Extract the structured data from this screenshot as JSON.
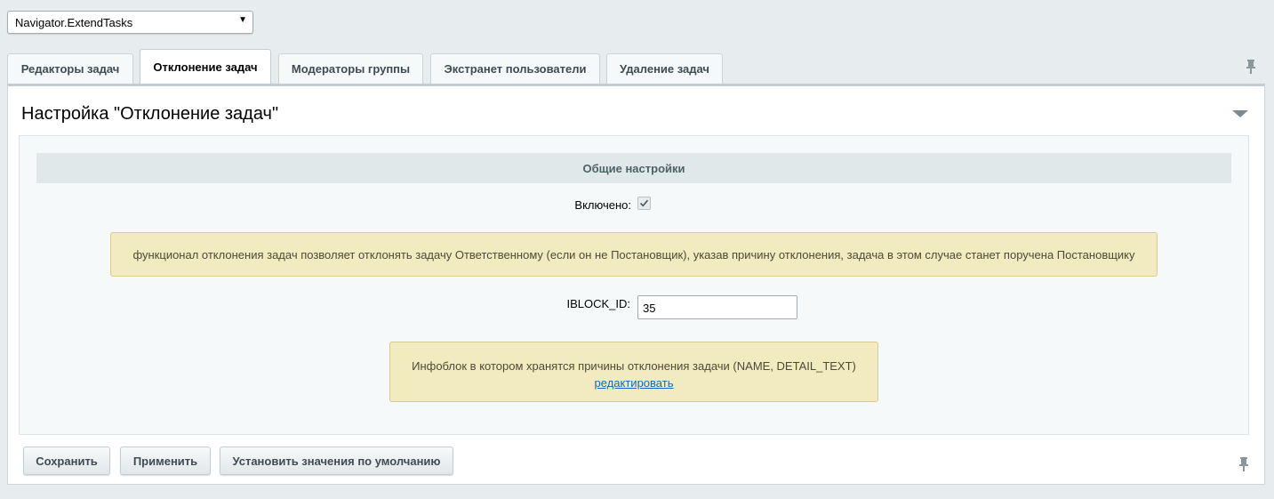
{
  "module_select": {
    "value": "Navigator.ExtendTasks"
  },
  "tabs": [
    {
      "label": "Редакторы задач",
      "active": false
    },
    {
      "label": "Отклонение задач",
      "active": true
    },
    {
      "label": "Модераторы группы",
      "active": false
    },
    {
      "label": "Экстранет пользователи",
      "active": false
    },
    {
      "label": "Удаление задач",
      "active": false
    }
  ],
  "panel": {
    "title": "Настройка \"Отклонение задач\"",
    "section_header": "Общие настройки",
    "enabled_label": "Включено:",
    "enabled_checked": true,
    "note1": "функционал отклонения задач позволяет отклонять задачу Ответственному (если он не Постановщик), указав причину отклонения, задача в этом случае станет поручена Постановщику",
    "iblock_label": "IBLOCK_ID:",
    "iblock_value": "35",
    "note2_text": "Инфоблок в котором хранятся причины отклонения задачи (NAME, DETAIL_TEXT)",
    "note2_link": "редактировать"
  },
  "buttons": {
    "save": "Сохранить",
    "apply": "Применить",
    "defaults": "Установить значения по умолчанию"
  },
  "icons": {
    "pin": "pin-icon",
    "collapse": "triangle-down-icon",
    "checkmark": "checkmark-icon",
    "dropdown": "dropdown-arrow-icon"
  },
  "colors": {
    "page_bg": "#e7ecee",
    "section_header_bg": "#e0e8ea",
    "note_bg": "#f1ebbf",
    "link": "#2067b0"
  }
}
